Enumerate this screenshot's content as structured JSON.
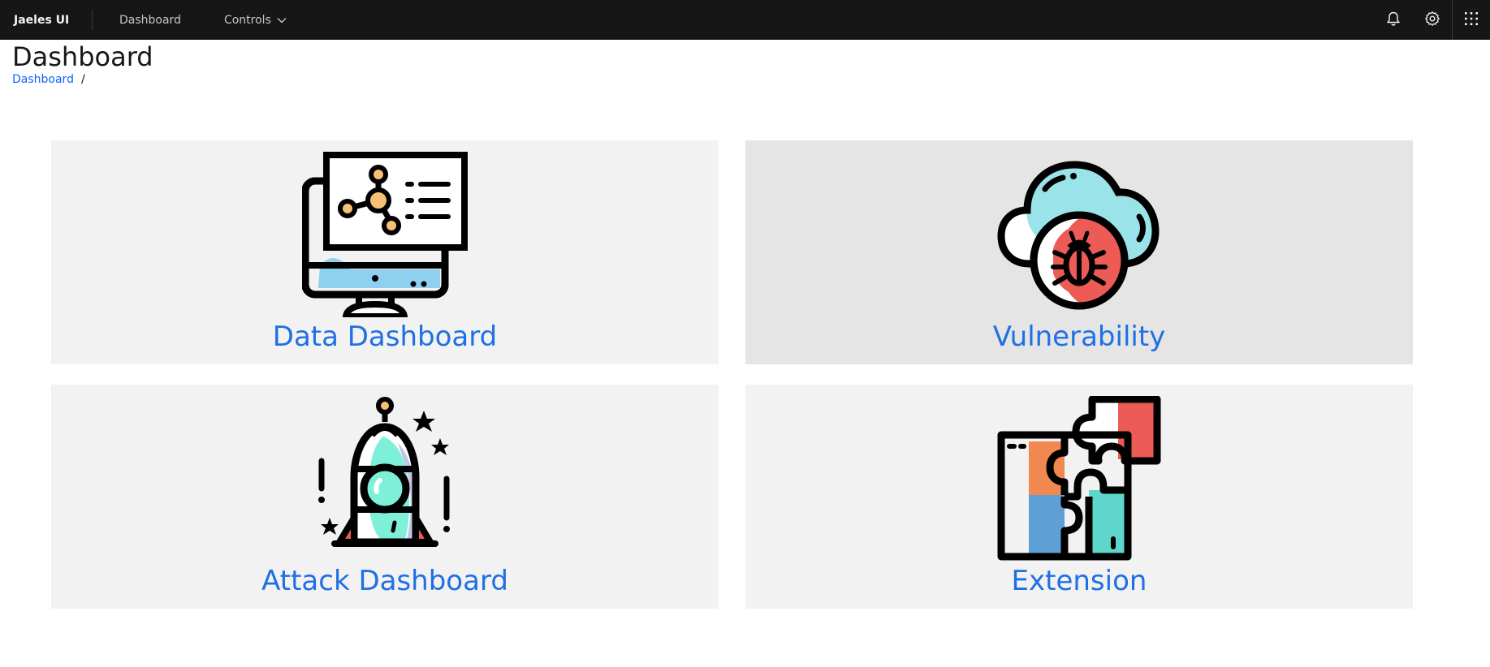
{
  "header": {
    "brand": "Jaeles UI",
    "nav": [
      {
        "label": "Dashboard"
      },
      {
        "label": "Controls"
      }
    ],
    "icons": [
      "notification-icon",
      "settings-icon",
      "app-switcher-icon"
    ]
  },
  "page": {
    "title": "Dashboard",
    "breadcrumb": {
      "item": "Dashboard",
      "separator": "/"
    }
  },
  "tiles": [
    {
      "label": "Data Dashboard",
      "icon": "monitor-network-icon"
    },
    {
      "label": "Vulnerability",
      "icon": "cloud-bug-icon"
    },
    {
      "label": "Attack Dashboard",
      "icon": "rocket-icon"
    },
    {
      "label": "Extension",
      "icon": "puzzle-icon"
    }
  ],
  "colors": {
    "header_bg": "#161616",
    "tile_bg": "#f2f2f2",
    "tile_active_bg": "#e5e5e5",
    "link": "#1f6fe5"
  }
}
